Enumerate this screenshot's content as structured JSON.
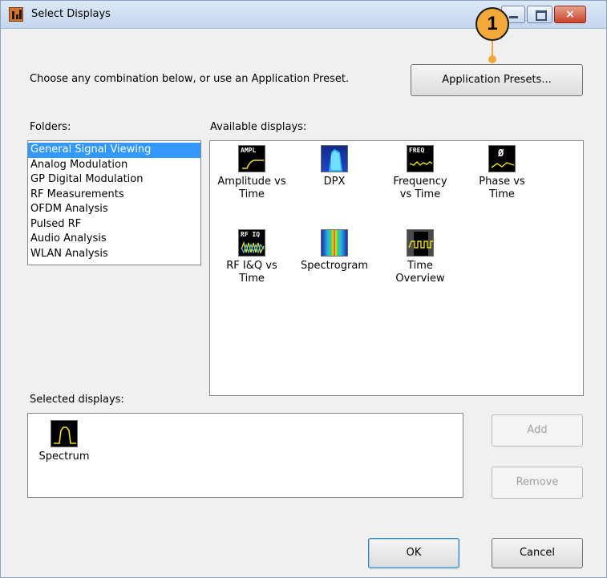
{
  "window": {
    "title": "Select Displays",
    "close_glyph": "×",
    "callout_number": "1",
    "colors": {
      "title_bar": "#c9d9ee",
      "selection": "#3399ff",
      "callout": "#f3a93a",
      "trace_yellow": "#f0e020"
    }
  },
  "header": {
    "instruction": "Choose any combination below, or use an Application Preset.",
    "presets_button": "Application Presets..."
  },
  "folders": {
    "label": "Folders:",
    "selected_index": 0,
    "items": [
      "General Signal Viewing",
      "Analog Modulation",
      "GP Digital Modulation",
      "RF Measurements",
      "OFDM Analysis",
      "Pulsed RF",
      "Audio Analysis",
      "WLAN Analysis"
    ]
  },
  "available": {
    "label": "Available displays:",
    "items": [
      {
        "label": "Amplitude vs\nTime",
        "icon": "amplitude-time-icon",
        "icon_text": "AMPL"
      },
      {
        "label": "DPX",
        "icon": "dpx-icon",
        "icon_text": ""
      },
      {
        "label": "Frequency\nvs Time",
        "icon": "frequency-time-icon",
        "icon_text": "FREQ"
      },
      {
        "label": "Phase vs\nTime",
        "icon": "phase-time-icon",
        "icon_text": "Ø"
      },
      {
        "label": "RF I&Q vs\nTime",
        "icon": "rf-iq-time-icon",
        "icon_text": "RF IQ"
      },
      {
        "label": "Spectrogram",
        "icon": "spectrogram-icon",
        "icon_text": ""
      },
      {
        "label": "Time\nOverview",
        "icon": "time-overview-icon",
        "icon_text": ""
      }
    ]
  },
  "selected": {
    "label": "Selected displays:",
    "items": [
      {
        "label": "Spectrum",
        "icon": "spectrum-icon"
      }
    ]
  },
  "buttons": {
    "add": "Add",
    "remove": "Remove",
    "ok": "OK",
    "cancel": "Cancel"
  }
}
